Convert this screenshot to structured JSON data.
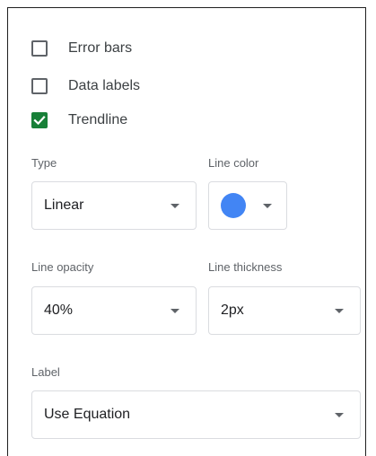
{
  "series": {
    "error_bars": {
      "label": "Error bars",
      "checked": false
    },
    "data_labels": {
      "label": "Data labels",
      "checked": false
    },
    "trendline": {
      "label": "Trendline",
      "checked": true
    }
  },
  "trendline": {
    "type": {
      "label": "Type",
      "value": "Linear"
    },
    "line_color": {
      "label": "Line color",
      "color": "#4285f4"
    },
    "line_opacity": {
      "label": "Line opacity",
      "value": "40%"
    },
    "line_thickness": {
      "label": "Line thickness",
      "value": "2px"
    },
    "label": {
      "label": "Label",
      "value": "Use Equation"
    }
  },
  "colors": {
    "check_green": "#188038",
    "border": "#dadce0",
    "text": "#3c4043",
    "muted": "#5f6368"
  }
}
